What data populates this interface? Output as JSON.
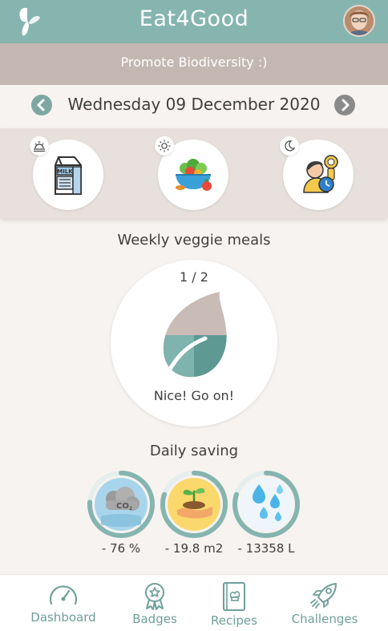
{
  "header": {
    "title": "Eat4Good",
    "logo_icon": "butterfly-icon",
    "avatar_icon": "user-avatar",
    "bar_color": "#86b5b0"
  },
  "banner": {
    "text": "Promote Biodiversity :)",
    "color": "#c4b7b1"
  },
  "date_nav": {
    "date": "Wednesday 09 December 2020",
    "prev_icon": "chevron-left-icon",
    "next_icon": "chevron-right-icon"
  },
  "meals": [
    {
      "slot": "breakfast",
      "time_icon": "sunrise-icon",
      "image_icon": "milk-carton-icon"
    },
    {
      "slot": "lunch",
      "time_icon": "sun-icon",
      "image_icon": "salad-bowl-icon"
    },
    {
      "slot": "dinner",
      "time_icon": "moon-icon",
      "image_icon": "person-clock-icon"
    }
  ],
  "weekly": {
    "title": "Weekly veggie meals",
    "count": "1 / 2",
    "progress": 0.5,
    "message": "Nice! Go on!"
  },
  "daily_saving": {
    "title": "Daily saving",
    "items": [
      {
        "metric": "co2",
        "icon": "co2-cloud-icon",
        "value": "- 76 %",
        "progress": 0.76
      },
      {
        "metric": "land",
        "icon": "sprout-hand-icon",
        "value": "- 19.8 m2",
        "progress": 0.8
      },
      {
        "metric": "water",
        "icon": "water-drops-icon",
        "value": "- 13358 L",
        "progress": 0.8
      }
    ],
    "ring_color": "#86b5b0",
    "ring_track_color": "#e4eeec"
  },
  "bottom_nav": {
    "items": [
      {
        "label": "Dashboard",
        "icon": "gauge-icon"
      },
      {
        "label": "Badges",
        "icon": "medal-icon"
      },
      {
        "label": "Recipes",
        "icon": "recipe-book-icon"
      },
      {
        "label": "Challenges",
        "icon": "rocket-icon"
      }
    ],
    "color": "#6fa09a"
  }
}
